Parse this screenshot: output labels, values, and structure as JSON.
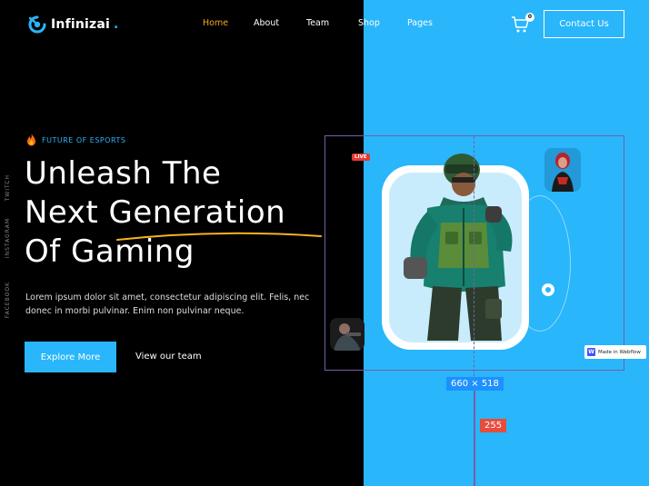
{
  "brand": {
    "name": "Infinizai",
    "dot": ".",
    "accent": "#29b6fb"
  },
  "nav": {
    "items": [
      {
        "label": "Home",
        "active": true
      },
      {
        "label": "About",
        "active": false
      },
      {
        "label": "Team",
        "active": false
      },
      {
        "label": "Shop",
        "active": false
      },
      {
        "label": "Pages",
        "active": false
      }
    ],
    "cart_count": "0",
    "contact_label": "Contact Us"
  },
  "social": [
    "TWITCH",
    "INSTAGRAM",
    "FACEBOOK"
  ],
  "hero": {
    "eyebrow": "FUTURE OF ESPORTS",
    "headline": [
      "Unleash The",
      "Next Generation",
      "Of Gaming"
    ],
    "paragraph": "Lorem ipsum dolor sit amet, consectetur adipiscing elit. Felis, nec donec in morbi pulvinar. Enim non pulvinar neque.",
    "primary_cta": "Explore More",
    "secondary_cta": "View our team"
  },
  "overlay": {
    "live_badge": "LIVE",
    "dimension_label": "660 × 518",
    "offset_label": "255",
    "badge_label": "Made in Webflow"
  },
  "colors": {
    "accent": "#29b6fb",
    "active_nav": "#f5a623",
    "selection": "#7a5ea8"
  }
}
